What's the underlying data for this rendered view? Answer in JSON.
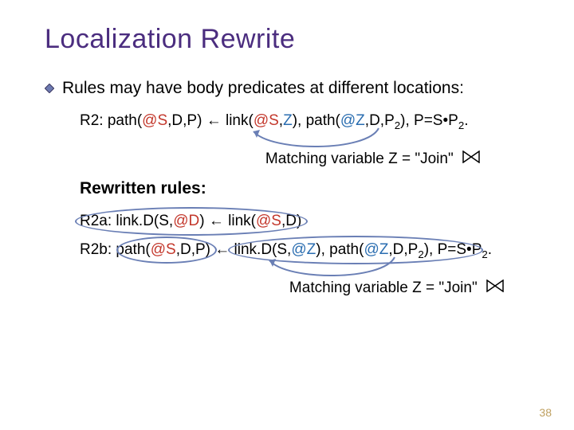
{
  "title": "Localization Rewrite",
  "bullet": "Rules may have body predicates at different locations:",
  "rule_r2": {
    "label": "R2: ",
    "p1a": "path(",
    "p1_loc": "@S",
    "p1b": ",D,P) ",
    "arrow": "←",
    "p2a": " link(",
    "p2_loc": "@S",
    "p2b": ",",
    "p2_var": "Z",
    "p2c": "), path(",
    "p3_loc": "@Z",
    "p3b": ",D,P",
    "p3_sub": "2",
    "p3c": "), P=S",
    "dot": "•",
    "p4a": "P",
    "p4_sub": "2",
    "p4b": "."
  },
  "match_text": "Matching variable Z = \"Join\"",
  "subhead": "Rewritten rules:",
  "rule_r2a": {
    "label": "R2a: ",
    "head_a": "link.D(S,",
    "head_loc": "@D",
    "head_b": ") ",
    "arrow": "←",
    "body_a": " link(",
    "body_loc": "@S",
    "body_b": ",D)"
  },
  "rule_r2b": {
    "label": "R2b: ",
    "p1a": "path(",
    "p1_loc": "@S",
    "p1b": ",D,P) ",
    "arrow": "←",
    "p2a": " link.D(S,",
    "p2_loc": "@Z",
    "p2b": "), path(",
    "p3_loc": "@Z",
    "p3b": ",D,P",
    "p3_sub": "2",
    "p3c": "), P=S",
    "dot": "•",
    "p4a": "P",
    "p4_sub": "2",
    "p4b": "."
  },
  "pagenum": "38"
}
